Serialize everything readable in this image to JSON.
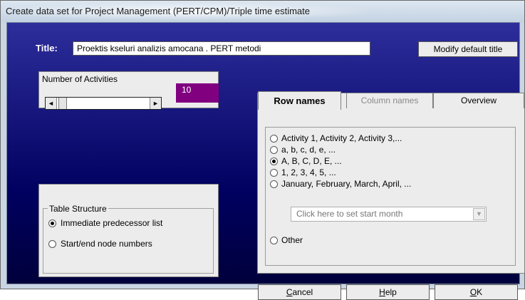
{
  "window": {
    "title": "Create data set for Project Management (PERT/CPM)/Triple time estimate"
  },
  "title_field": {
    "label": "Title:",
    "value": "Proektis kseluri analizis amocana . PERT metodi"
  },
  "modify_button": "Modify default title",
  "activities": {
    "label": "Number of Activities",
    "value": "10",
    "left_arrow": "◄",
    "right_arrow": "►"
  },
  "table_structure": {
    "title": "Table Structure",
    "options": [
      {
        "label": "Immediate predecessor list",
        "selected": true
      },
      {
        "label": "Start/end node numbers",
        "selected": false
      }
    ]
  },
  "tabs": [
    {
      "label": "Row names",
      "active": true
    },
    {
      "label": "Column names",
      "active": false
    },
    {
      "label": "Overview",
      "active": false
    }
  ],
  "row_names": {
    "options": [
      {
        "label": "Activity 1, Activity 2, Activity 3,...",
        "selected": false
      },
      {
        "label": "a, b, c, d, e, ...",
        "selected": false
      },
      {
        "label": "A, B, C, D, E, ...",
        "selected": true
      },
      {
        "label": "1, 2, 3, 4, 5, ...",
        "selected": false
      },
      {
        "label": "January, February, March, April, ...",
        "selected": false
      },
      {
        "label": "Other",
        "selected": false
      }
    ],
    "month_combo": {
      "placeholder": "Click here to set start month",
      "arrow": "▼"
    }
  },
  "buttons": {
    "cancel": {
      "first": "C",
      "rest": "ancel"
    },
    "help": {
      "first": "H",
      "rest": "elp"
    },
    "ok": {
      "first": "O",
      "rest": "K"
    }
  }
}
